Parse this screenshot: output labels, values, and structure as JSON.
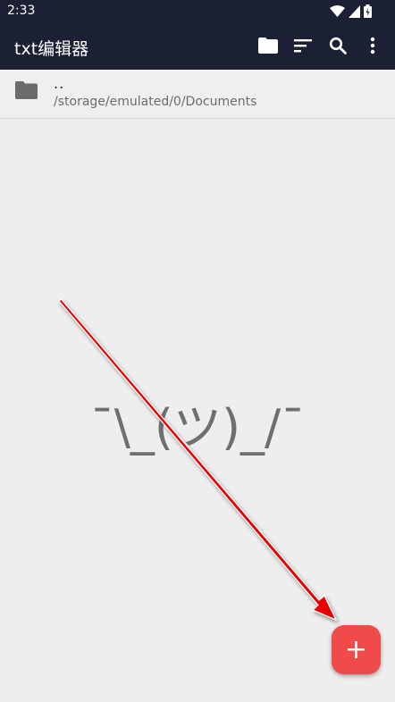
{
  "status_bar": {
    "time": "2:33"
  },
  "app_bar": {
    "title": "txt编辑器",
    "actions": [
      "folder-icon",
      "sort-icon",
      "search-icon",
      "more-vert-icon"
    ]
  },
  "file_list": {
    "parent": {
      "name": "..",
      "path": "/storage/emulated/0/Documents",
      "icon": "folder-icon"
    }
  },
  "empty_state": {
    "text": "¯\\_(ツ)_/¯"
  },
  "fab": {
    "label": "+",
    "color": "#ef4b4b"
  },
  "colors": {
    "appbar": "#1c2034",
    "background": "#eeeeee",
    "accent": "#ef4b4b"
  }
}
